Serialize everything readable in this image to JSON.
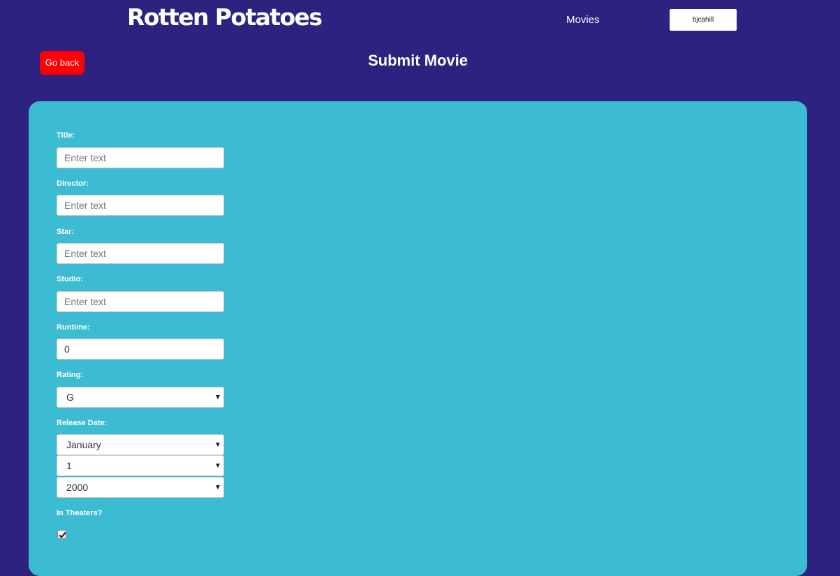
{
  "header": {
    "brand": "Rotten Potatoes",
    "nav_movies": "Movies",
    "user_button": "bjcahill"
  },
  "page": {
    "back_button": "Go back",
    "title": "Submit Movie"
  },
  "form": {
    "title_label": "Title:",
    "title_placeholder": "Enter text",
    "director_label": "Director:",
    "director_placeholder": "Enter text",
    "star_label": "Star:",
    "star_placeholder": "Enter text",
    "studio_label": "Studio:",
    "studio_placeholder": "Enter text",
    "runtime_label": "Runtime:",
    "runtime_value": "0",
    "rating_label": "Rating:",
    "rating_value": "G",
    "release_label": "Release Date:",
    "release_month": "January",
    "release_day": "1",
    "release_year": "2000",
    "theaters_label": "In Theaters?",
    "in_theaters": true
  },
  "colors": {
    "background": "#2d2280",
    "panel": "#3bbcd3",
    "back_button": "#ff0000"
  }
}
